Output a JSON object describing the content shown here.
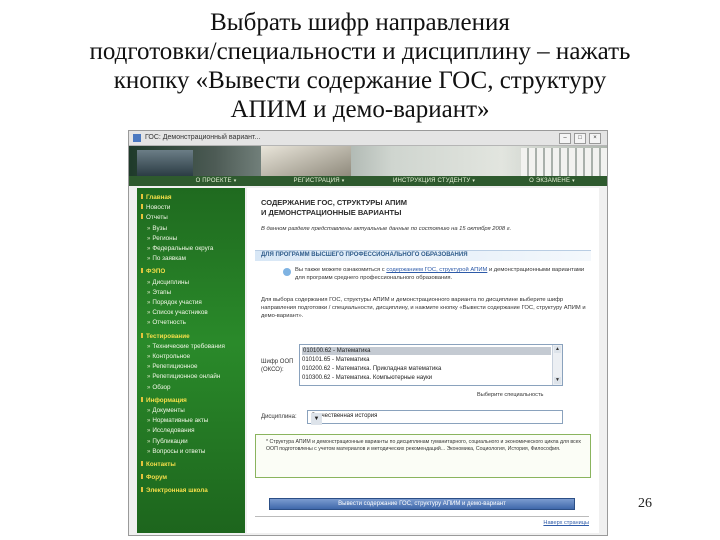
{
  "slide": {
    "title_lines": [
      "Выбрать шифр направления",
      "подготовки/специальности  и дисциплину  – нажать",
      "кнопку «Вывести содержание ГОС, структуру",
      "АПИМ и демо-вариант»"
    ],
    "page_number": "26"
  },
  "browser": {
    "window_title": "ГОС: Демонстрационный вариант..."
  },
  "nav": {
    "items": [
      "О ПРОЕКТЕ",
      "РЕГИСТРАЦИЯ",
      "ИНСТРУКЦИЯ СТУДЕНТУ",
      "О ЭКЗАМЕНЕ"
    ]
  },
  "sidebar": {
    "items": [
      {
        "label": "Главная",
        "type": "sec"
      },
      {
        "label": "Новости",
        "type": "item"
      },
      {
        "label": "Отчеты",
        "type": "item"
      },
      {
        "label": "Вузы",
        "type": "sub"
      },
      {
        "label": "Регионы",
        "type": "sub"
      },
      {
        "label": "Федеральные округа",
        "type": "sub"
      },
      {
        "label": "По заявкам",
        "type": "sub"
      },
      {
        "label": "ФЭПО",
        "type": "sec"
      },
      {
        "label": "Дисциплины",
        "type": "sub"
      },
      {
        "label": "Этапы",
        "type": "sub"
      },
      {
        "label": "Порядок участия",
        "type": "sub"
      },
      {
        "label": "Список участников",
        "type": "sub"
      },
      {
        "label": "Отчетность",
        "type": "sub"
      },
      {
        "label": "Тестирование",
        "type": "sec"
      },
      {
        "label": "Технические требования",
        "type": "sub"
      },
      {
        "label": "Контрольное",
        "type": "sub"
      },
      {
        "label": "Репетиционное",
        "type": "sub"
      },
      {
        "label": "Репетиционное онлайн",
        "type": "sub"
      },
      {
        "label": "Обзор",
        "type": "sub"
      },
      {
        "label": "Информация",
        "type": "sec"
      },
      {
        "label": "Документы",
        "type": "sub"
      },
      {
        "label": "Нормативные акты",
        "type": "sub"
      },
      {
        "label": "Исследования",
        "type": "sub"
      },
      {
        "label": "Публикации",
        "type": "sub"
      },
      {
        "label": "Вопросы и ответы",
        "type": "sub"
      },
      {
        "label": "Контакты",
        "type": "sec"
      },
      {
        "label": "Форум",
        "type": "sec"
      },
      {
        "label": "Электронная школа",
        "type": "sec"
      }
    ]
  },
  "main": {
    "heading": "СОДЕРЖАНИЕ ГОС, СТРУКТУРЫ АПИМ\nИ ДЕМОНСТРАЦИОННЫЕ ВАРИАНТЫ",
    "note": "В данном разделе представлены актуальные данные по состоянию на 15 октября 2008 г.",
    "band": "ДЛЯ ПРОГРАММ ВЫСШЕГО ПРОФЕССИОНАЛЬНОГО ОБРАЗОВАНИЯ",
    "para1_prefix": "Вы также можете ознакомиться с ",
    "para1_link": "содержанием ГОС, структурой АПИМ",
    "para1_suffix": " и демонстрационными вариантами для программ среднего профессионального образования.",
    "para2": "Для выбора содержания ГОС, структуры АПИМ и демонстрационного варианта по дисциплине выберите шифр направления подготовки / специальности, дисциплину, и нажмите кнопку «Вывести содержание ГОС, структуру АПИМ и демо-вариант».",
    "code_label": "Шифр ООП (ОКСО):",
    "options": [
      "010100.62 - Математика",
      "010101.65 - Математика",
      "010200.62 - Математика. Прикладная математика",
      "010300.62 - Математика. Компьютерные науки"
    ],
    "selected_index": 0,
    "hint": "Выберите специальность",
    "discipline_label": "Дисциплина:",
    "discipline_value": "Отечественная история",
    "info": "* Структура АПИМ и демонстрационные варианты по дисциплинам гуманитарного, социального и экономического цикла для всех ООП подготовлены с учетом материалов и методических рекомендаций... Экономика, Социология, История, Философия.",
    "submit_label": "Вывести содержание ГОС, структуру АПИМ и демо-вариант",
    "footer_link": "Наверх страницы"
  }
}
